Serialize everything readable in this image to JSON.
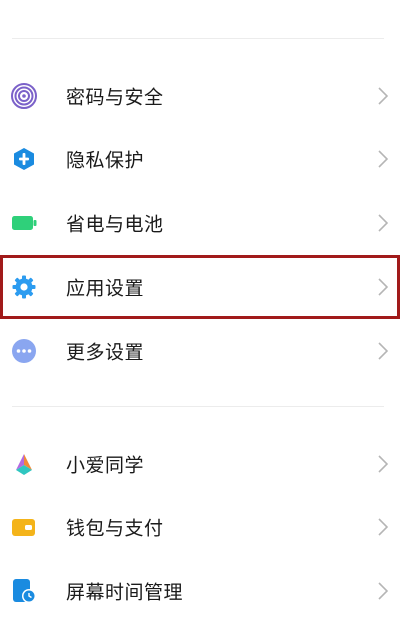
{
  "settings": {
    "group1": [
      {
        "label": "密码与安全",
        "icon": "fingerprint-icon"
      },
      {
        "label": "隐私保护",
        "icon": "privacy-shield-icon"
      },
      {
        "label": "省电与电池",
        "icon": "battery-icon"
      },
      {
        "label": "应用设置",
        "icon": "gear-icon",
        "highlighted": true
      },
      {
        "label": "更多设置",
        "icon": "more-dots-icon"
      }
    ],
    "group2": [
      {
        "label": "小爱同学",
        "icon": "xiaoai-icon"
      },
      {
        "label": "钱包与支付",
        "icon": "wallet-icon"
      },
      {
        "label": "屏幕时间管理",
        "icon": "screen-time-icon"
      }
    ]
  },
  "colors": {
    "highlight_border": "#a11a1a",
    "fingerprint": "#7b61c9",
    "privacy": "#1a8be0",
    "battery": "#2fd07a",
    "gear": "#2c9cf0",
    "more": "#8aa6f0",
    "wallet": "#f4b41a",
    "screen_time": "#1a8be0"
  }
}
